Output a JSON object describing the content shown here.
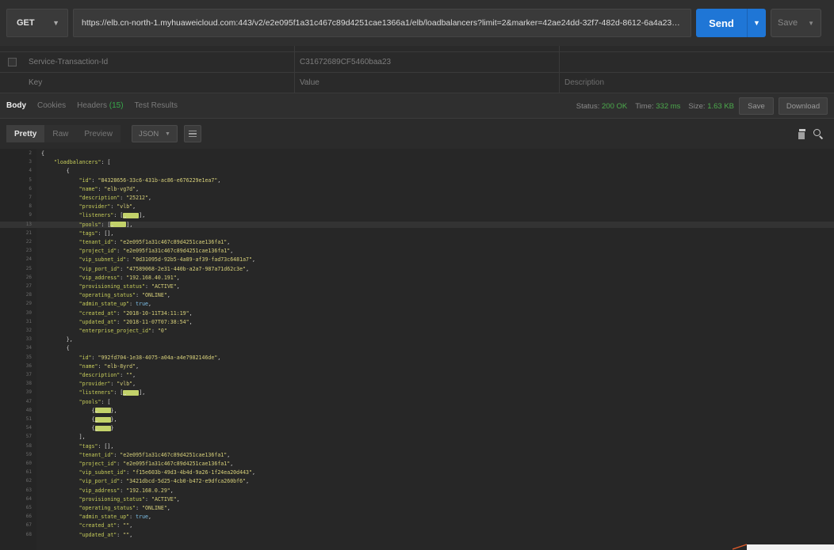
{
  "request": {
    "method": "GET",
    "url": "https://elb.cn-north-1.myhuaweicloud.com:443/v2/e2e095f1a31c467c89d4251cae1366a1/elb/loadbalancers?limit=2&marker=42ae24dd-32f7-482d-8612-6a4a23320...",
    "send_label": "Send",
    "save_label": "Save"
  },
  "params": {
    "rows": [
      {
        "key": "Service-Transaction-Id",
        "value": "C31672689CF5460baa23",
        "description": ""
      },
      {
        "key": "Key",
        "value": "Value",
        "description": "Description"
      }
    ]
  },
  "response": {
    "tabs": [
      {
        "label": "Body",
        "active": true
      },
      {
        "label": "Cookies",
        "active": false
      },
      {
        "label": "Headers",
        "count": "(15)",
        "active": false
      },
      {
        "label": "Test Results",
        "active": false
      }
    ],
    "status_label": "Status:",
    "status_value": "200 OK",
    "time_label": "Time:",
    "time_value": "332 ms",
    "size_label": "Size:",
    "size_value": "1.63 KB",
    "save_label": "Save",
    "download_label": "Download"
  },
  "toolbar": {
    "modes": [
      "Pretty",
      "Raw",
      "Preview"
    ],
    "format": "JSON"
  },
  "editor": {
    "lines": [
      {
        "n": "2",
        "t": "{"
      },
      {
        "n": "3",
        "t": "    \"loadbalancers\": ["
      },
      {
        "n": "4",
        "t": "        {"
      },
      {
        "n": "5",
        "t": "            \"id\": \"84328656-33c6-431b-ac86-e676229e1ea7\","
      },
      {
        "n": "6",
        "t": "            \"name\": \"elb-vg7d\","
      },
      {
        "n": "7",
        "t": "            \"description\": \"25212\","
      },
      {
        "n": "8",
        "t": "            \"provider\": \"vlb\","
      },
      {
        "n": "9",
        "t": "            \"listeners\": […],"
      },
      {
        "n": "13",
        "t": "            \"pools\": […],"
      },
      {
        "n": "21",
        "t": "            \"tags\": [],"
      },
      {
        "n": "22",
        "t": "            \"tenant_id\": \"e2e095f1a31c467c89d4251cae136fa1\","
      },
      {
        "n": "23",
        "t": "            \"project_id\": \"e2e095f1a31c467c89d4251cae136fa1\","
      },
      {
        "n": "24",
        "t": "            \"vip_subnet_id\": \"0d31095d-92b5-4a89-af39-fad73c6481a7\","
      },
      {
        "n": "25",
        "t": "            \"vip_port_id\": \"47589068-2e31-440b-a2a7-987a71d62c3e\","
      },
      {
        "n": "26",
        "t": "            \"vip_address\": \"192.168.40.191\","
      },
      {
        "n": "27",
        "t": "            \"provisioning_status\": \"ACTIVE\","
      },
      {
        "n": "28",
        "t": "            \"operating_status\": \"ONLINE\","
      },
      {
        "n": "29",
        "t": "            \"admin_state_up\": true,"
      },
      {
        "n": "30",
        "t": "            \"created_at\": \"2018-10-11T34:11:19\","
      },
      {
        "n": "31",
        "t": "            \"updated_at\": \"2018-11-07T07:38:54\","
      },
      {
        "n": "32",
        "t": "            \"enterprise_project_id\": \"0\""
      },
      {
        "n": "33",
        "t": "        },"
      },
      {
        "n": "34",
        "t": "        {"
      },
      {
        "n": "35",
        "t": "            \"id\": \"992fd704-1e38-4075-a04a-a4e7982146de\","
      },
      {
        "n": "36",
        "t": "            \"name\": \"elb-8yrd\","
      },
      {
        "n": "37",
        "t": "            \"description\": \"\","
      },
      {
        "n": "38",
        "t": "            \"provider\": \"vlb\","
      },
      {
        "n": "39",
        "t": "            \"listeners\": […],"
      },
      {
        "n": "47",
        "t": "            \"pools\": ["
      },
      {
        "n": "48",
        "t": "                {…},"
      },
      {
        "n": "51",
        "t": "                {…},"
      },
      {
        "n": "54",
        "t": "                {…}"
      },
      {
        "n": "57",
        "t": "            ],"
      },
      {
        "n": "58",
        "t": "            \"tags\": [],"
      },
      {
        "n": "59",
        "t": "            \"tenant_id\": \"e2e095f1a31c467c89d4251cae136fa1\","
      },
      {
        "n": "60",
        "t": "            \"project_id\": \"e2e095f1a31c467c89d4251cae136fa1\","
      },
      {
        "n": "61",
        "t": "            \"vip_subnet_id\": \"f15e603b-49d3-4b4d-9a26-1f24ea20d443\","
      },
      {
        "n": "62",
        "t": "            \"vip_port_id\": \"3421dbcd-5d25-4cb0-b472-e9dfca260bf6\","
      },
      {
        "n": "63",
        "t": "            \"vip_address\": \"192.168.0.29\","
      },
      {
        "n": "64",
        "t": "            \"provisioning_status\": \"ACTIVE\","
      },
      {
        "n": "65",
        "t": "            \"operating_status\": \"ONLINE\","
      },
      {
        "n": "66",
        "t": "            \"admin_state_up\": true,"
      },
      {
        "n": "67",
        "t": "            \"created_at\": \"\","
      },
      {
        "n": "68",
        "t": "            \"updated_at\": \"\","
      }
    ]
  },
  "colors": {
    "accent": "#1f76d6",
    "background": "#2b2b2b",
    "status_ok": "#4caa4c",
    "json_key": "#c6cc5a",
    "json_string": "#d7d07a",
    "json_bool": "#7dc0e8"
  },
  "icons": [
    "chevron-down-icon",
    "wrap-lines-icon",
    "copy-icon",
    "search-icon"
  ]
}
